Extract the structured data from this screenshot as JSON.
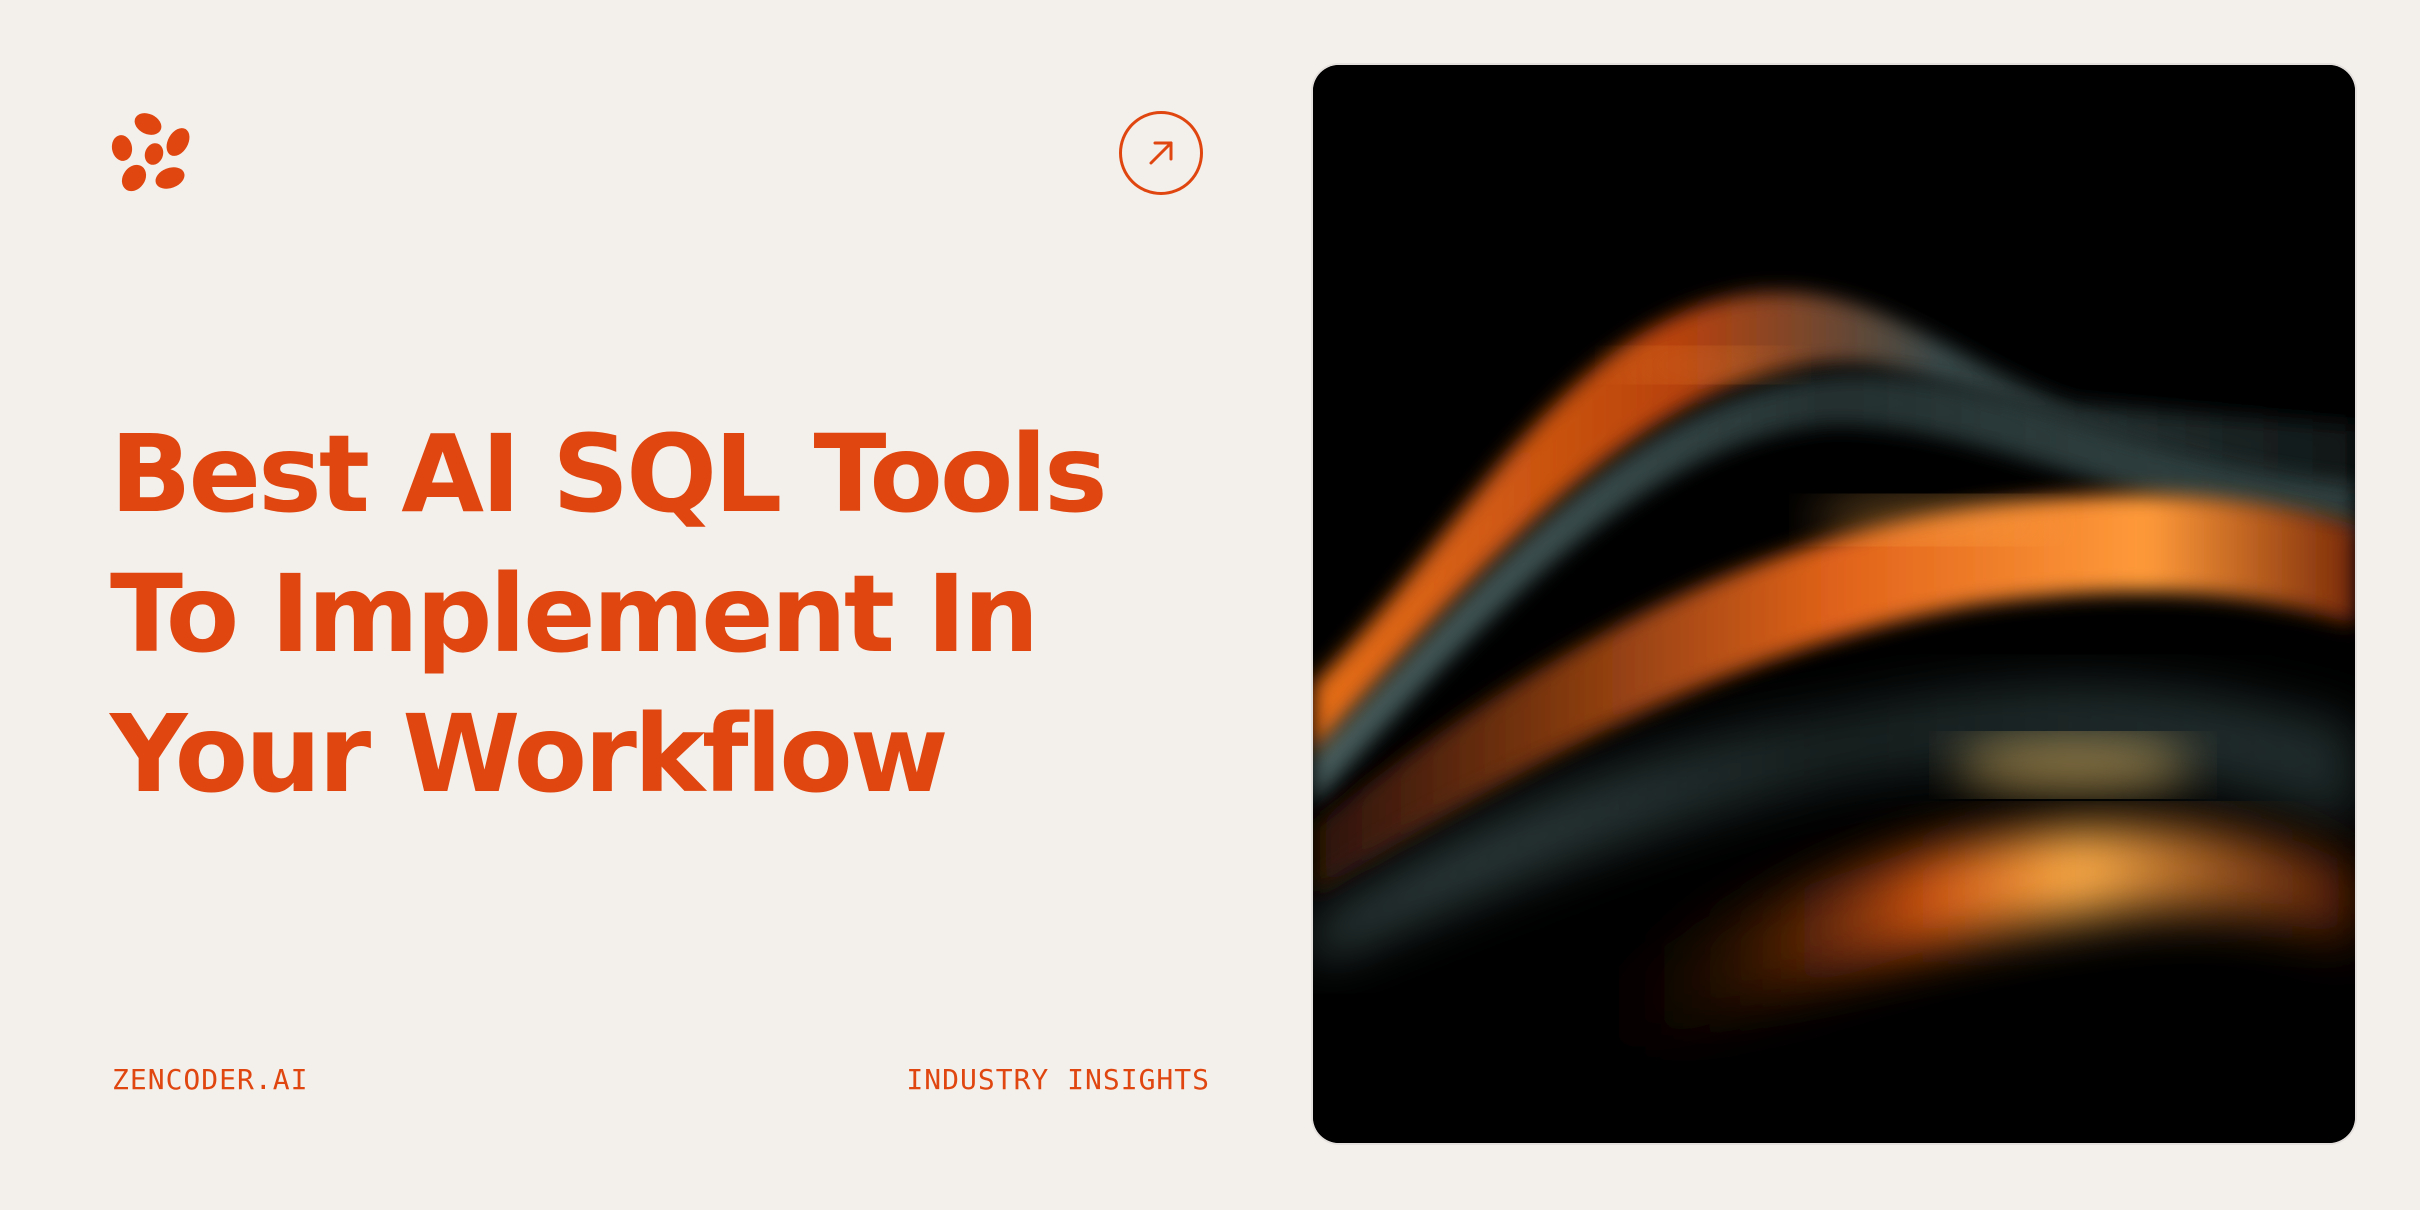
{
  "brand": {
    "logo_icon": "flower-petals-icon",
    "accent_color": "#e0460f",
    "background_color": "#f3efeb"
  },
  "arrow_button": {
    "icon": "arrow-up-right-icon"
  },
  "headline": {
    "line1": "Best AI SQL Tools",
    "line2": "To Implement In",
    "line3": "Your Workflow"
  },
  "footer": {
    "site": "ZENCODER.AI",
    "category": "INDUSTRY INSIGHTS"
  },
  "hero": {
    "icon": "abstract-wave-image"
  }
}
